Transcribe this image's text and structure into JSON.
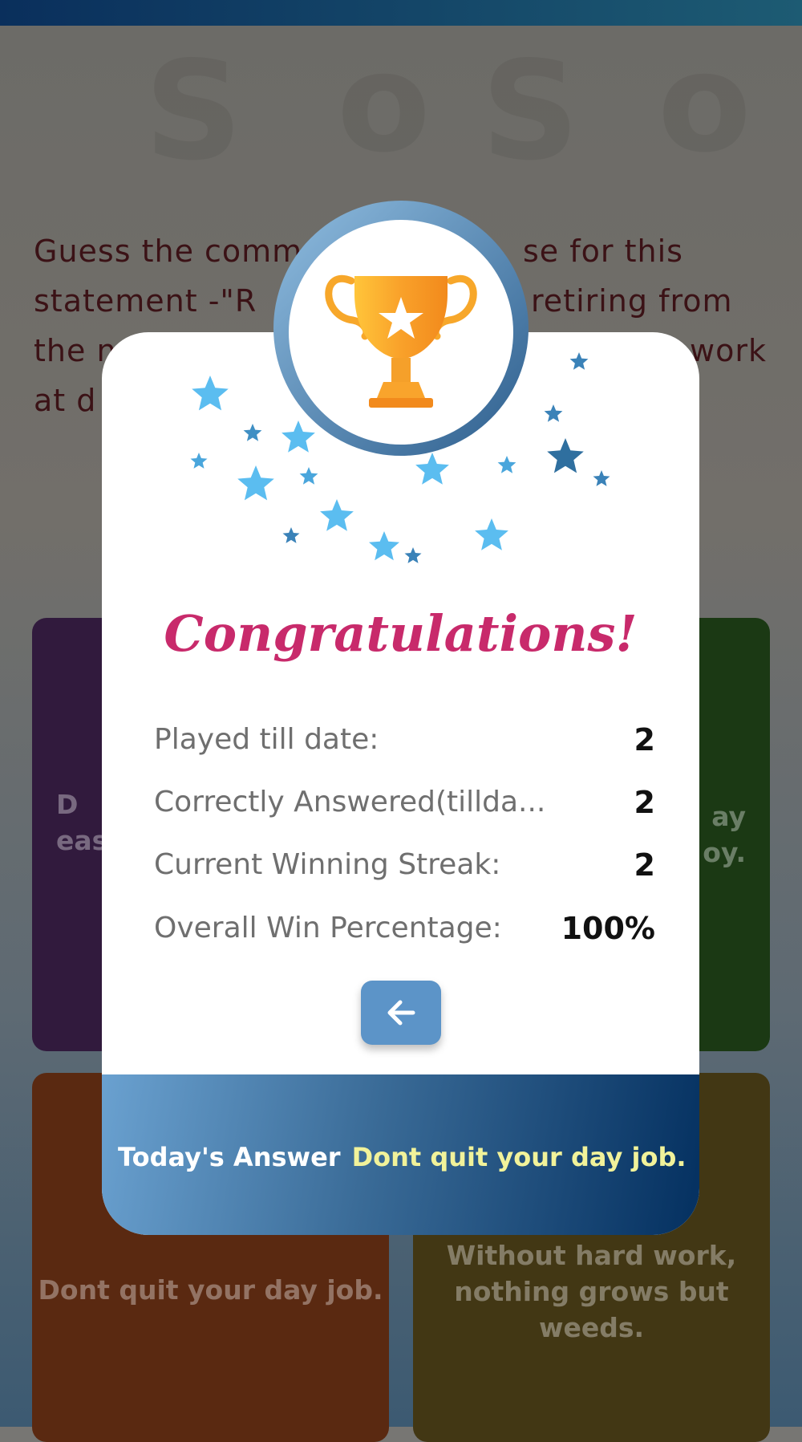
{
  "question": {
    "line1": "Guess the comm",
    "line1b": "se for this",
    "line2": "statement -\"R",
    "line2b": "retiring from",
    "line3": "the n",
    "line3b": "work",
    "line4": "at d"
  },
  "options": [
    {
      "text": "D\neas"
    },
    {
      "text": "ay\noy."
    },
    {
      "text": "Dont quit your day job."
    },
    {
      "text": "Without hard work, nothing grows but weeds."
    }
  ],
  "modal": {
    "title": "Congratulations!",
    "stats": [
      {
        "label": "Played till date:",
        "value": "2"
      },
      {
        "label": "Correctly Answered(tillda...",
        "value": "2"
      },
      {
        "label": "Current Winning Streak:",
        "value": "2"
      },
      {
        "label": "Overall Win Percentage:",
        "value": "100%"
      }
    ],
    "answer_label": "Today's Answer",
    "answer_value": "Dont quit your day job."
  },
  "colors": {
    "title": "#c82a6b",
    "back_button": "#5c94c8",
    "answer_highlight": "#f1f29a"
  },
  "icons": {
    "trophy": "trophy-icon",
    "back": "arrow-left-icon",
    "stars": "star-icon"
  }
}
